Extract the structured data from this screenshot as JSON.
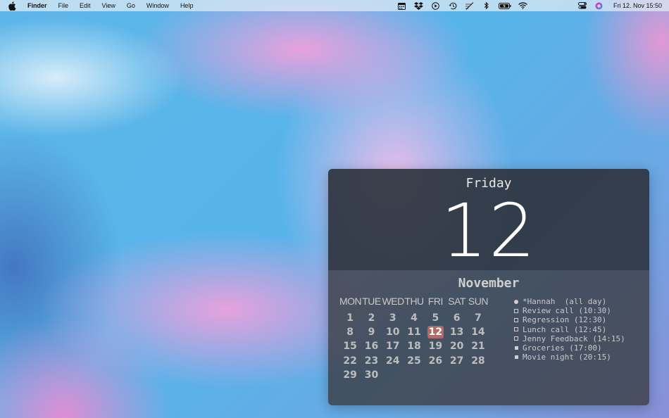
{
  "menubar": {
    "app_name": "Finder",
    "menus": [
      "File",
      "Edit",
      "View",
      "Go",
      "Window",
      "Help"
    ],
    "status_icons": [
      "calendar-icon",
      "dropbox-icon",
      "play-icon",
      "time-machine-icon",
      "slash-icon",
      "bluetooth-icon",
      "battery-icon",
      "wifi-icon",
      "control-center-icon",
      "siri-icon"
    ],
    "clock": "Fri 12. Nov  15:50"
  },
  "widget": {
    "day_name": "Friday",
    "day_number": "12",
    "month": "November",
    "weekdays": [
      "MON",
      "TUE",
      "WED",
      "THU",
      "FRI",
      "SAT",
      "SUN"
    ],
    "days": [
      "1",
      "2",
      "3",
      "4",
      "5",
      "6",
      "7",
      "8",
      "9",
      "10",
      "11",
      "12",
      "13",
      "14",
      "15",
      "16",
      "17",
      "18",
      "19",
      "20",
      "21",
      "22",
      "23",
      "24",
      "25",
      "26",
      "27",
      "28",
      "29",
      "30"
    ],
    "today": "12",
    "today_color": "#b06a6a",
    "events": [
      {
        "marker": "dot",
        "text": "*Hannah  (all day)"
      },
      {
        "marker": "open",
        "text": "Review call (10:30)"
      },
      {
        "marker": "open",
        "text": "Regression (12:30)"
      },
      {
        "marker": "open",
        "text": "Lunch call (12:45)"
      },
      {
        "marker": "open",
        "text": "Jenny Feedback (14:15)"
      },
      {
        "marker": "filled",
        "text": "Groceries (17:00)"
      },
      {
        "marker": "filled",
        "text": "Movie night (20:15)"
      }
    ]
  }
}
